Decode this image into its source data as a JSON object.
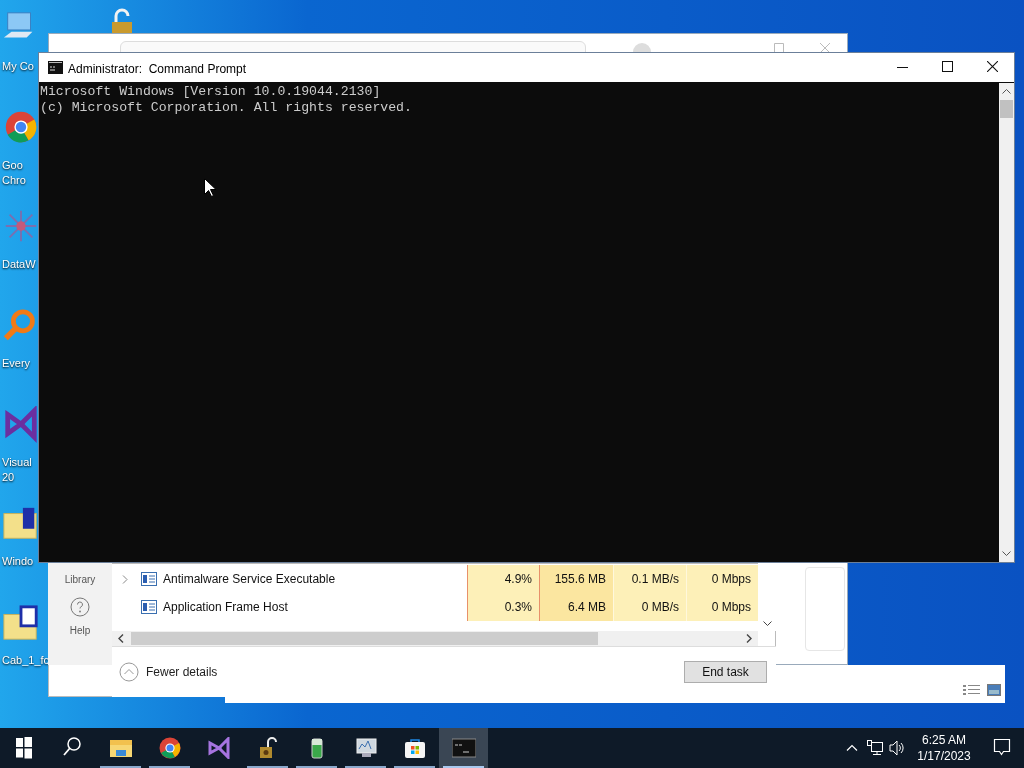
{
  "desktop": {
    "icons": [
      {
        "kind": "computer",
        "label_lines": [
          "My Co"
        ]
      },
      {
        "kind": "chrome",
        "label_lines": [
          "Goo",
          "Chro"
        ]
      },
      {
        "kind": "grid",
        "label_lines": [
          "DataW"
        ]
      },
      {
        "kind": "magnifier",
        "label_lines": [
          "Every"
        ]
      },
      {
        "kind": "vs",
        "label_lines": [
          "Visual",
          "20"
        ]
      },
      {
        "kind": "folder",
        "label_lines": [
          "Windo"
        ]
      },
      {
        "kind": "folder-doc",
        "label_lines": [
          "Cab_1_fc"
        ]
      }
    ]
  },
  "command_prompt": {
    "title": "Administrator:  Command Prompt",
    "lines": [
      "Microsoft Windows [Version 10.0.19044.2130]",
      "(c) Microsoft Corporation. All rights reserved."
    ]
  },
  "task_manager": {
    "sidebar": [
      {
        "kind": "text",
        "label": "Library"
      },
      {
        "kind": "help",
        "label": "Help"
      }
    ],
    "rows": [
      {
        "name": "Antimalware Service Executable",
        "expandable": true,
        "cpu": "4.9%",
        "memory": "155.6 MB",
        "disk": "0.1 MB/s",
        "network": "0 Mbps"
      },
      {
        "name": "Application Frame Host",
        "expandable": false,
        "cpu": "0.3%",
        "memory": "6.4 MB",
        "disk": "0 MB/s",
        "network": "0 Mbps"
      }
    ],
    "fewer_details": "Fewer details",
    "end_task": "End task"
  },
  "taskbar": {
    "apps": [
      {
        "kind": "explorer",
        "running": true,
        "selected": false
      },
      {
        "kind": "chrome",
        "running": true,
        "selected": false
      },
      {
        "kind": "vs",
        "running": false,
        "selected": false
      },
      {
        "kind": "lock",
        "running": true,
        "selected": false
      },
      {
        "kind": "battery",
        "running": true,
        "selected": false
      },
      {
        "kind": "monitor",
        "running": true,
        "selected": false
      },
      {
        "kind": "store",
        "running": true,
        "selected": false
      },
      {
        "kind": "console",
        "running": true,
        "selected": true
      }
    ],
    "time": "6:25 AM",
    "date": "1/17/2023"
  }
}
